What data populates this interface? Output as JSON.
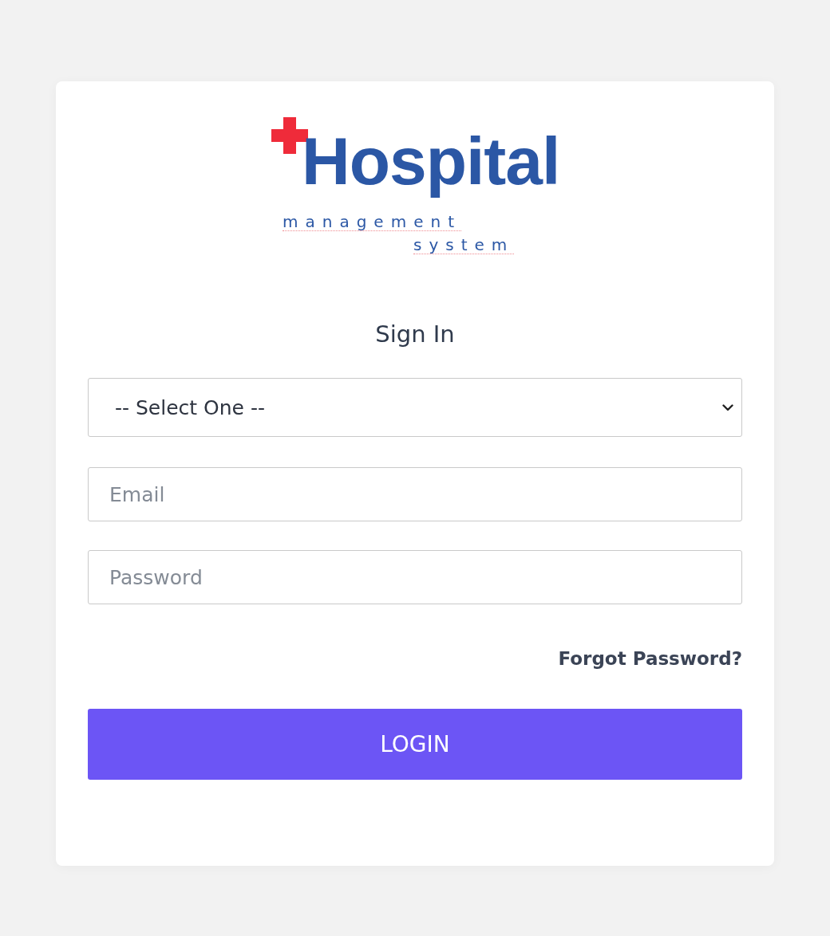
{
  "logo": {
    "title": "Hospital",
    "line_1": "management",
    "line_2": "system"
  },
  "heading": "Sign In",
  "role_select": {
    "value": "-- Select One --"
  },
  "fields": [
    {
      "placeholder": "Email"
    },
    {
      "placeholder": "Password"
    }
  ],
  "forgot_link": "Forgot Password?",
  "login_button": "LOGIN"
}
